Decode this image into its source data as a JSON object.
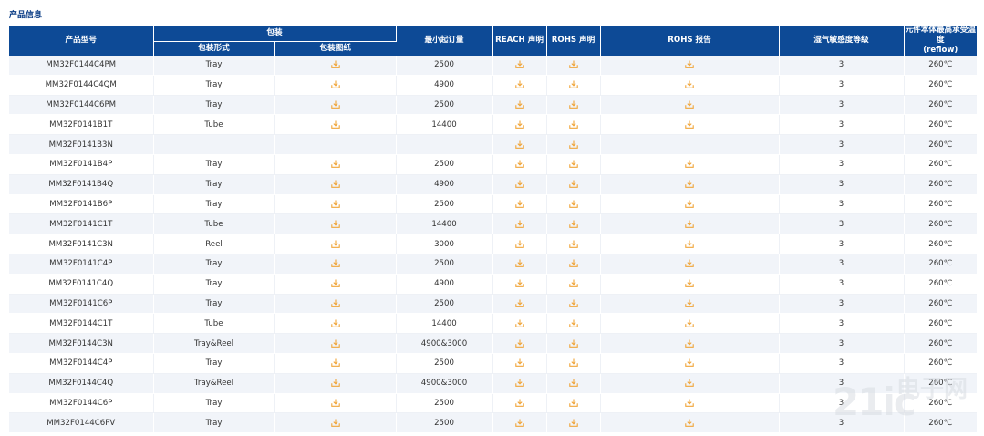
{
  "section_title": "产品信息",
  "header": {
    "model": "产品型号",
    "packaging": "包装",
    "packaging_form": "包装形式",
    "packaging_drawing": "包装图纸",
    "moq": "最小起订量",
    "reach": "REACH 声明",
    "rohs_decl": "ROHS 声明",
    "rohs_report": "ROHS 报告",
    "msl": "湿气敏感度等级",
    "reflow_line1": "元件本体最高承受温度",
    "reflow_line2": "(reflow)"
  },
  "icons": {
    "download": "download-icon",
    "color": "#f0a53a"
  },
  "colors": {
    "header_bg": "#0d4a96",
    "title": "#0d3e86"
  },
  "rows": [
    {
      "model": "MM32F0144C4PM",
      "form": "Tray",
      "drawing": true,
      "moq": "2500",
      "reach": true,
      "rohs": true,
      "report": true,
      "msl": "3",
      "temp": "260℃"
    },
    {
      "model": "MM32F0144C4QM",
      "form": "Tray",
      "drawing": true,
      "moq": "4900",
      "reach": true,
      "rohs": true,
      "report": true,
      "msl": "3",
      "temp": "260℃"
    },
    {
      "model": "MM32F0144C6PM",
      "form": "Tray",
      "drawing": true,
      "moq": "2500",
      "reach": true,
      "rohs": true,
      "report": true,
      "msl": "3",
      "temp": "260℃"
    },
    {
      "model": "MM32F0141B1T",
      "form": "Tube",
      "drawing": true,
      "moq": "14400",
      "reach": true,
      "rohs": true,
      "report": true,
      "msl": "3",
      "temp": "260℃"
    },
    {
      "model": "MM32F0141B3N",
      "form": "",
      "drawing": false,
      "moq": "",
      "reach": true,
      "rohs": true,
      "report": false,
      "msl": "3",
      "temp": "260℃"
    },
    {
      "model": "MM32F0141B4P",
      "form": "Tray",
      "drawing": true,
      "moq": "2500",
      "reach": true,
      "rohs": true,
      "report": true,
      "msl": "3",
      "temp": "260℃"
    },
    {
      "model": "MM32F0141B4Q",
      "form": "Tray",
      "drawing": true,
      "moq": "4900",
      "reach": true,
      "rohs": true,
      "report": true,
      "msl": "3",
      "temp": "260℃"
    },
    {
      "model": "MM32F0141B6P",
      "form": "Tray",
      "drawing": true,
      "moq": "2500",
      "reach": true,
      "rohs": true,
      "report": true,
      "msl": "3",
      "temp": "260℃"
    },
    {
      "model": "MM32F0141C1T",
      "form": "Tube",
      "drawing": true,
      "moq": "14400",
      "reach": true,
      "rohs": true,
      "report": true,
      "msl": "3",
      "temp": "260℃"
    },
    {
      "model": "MM32F0141C3N",
      "form": "Reel",
      "drawing": true,
      "moq": "3000",
      "reach": true,
      "rohs": true,
      "report": true,
      "msl": "3",
      "temp": "260℃"
    },
    {
      "model": "MM32F0141C4P",
      "form": "Tray",
      "drawing": true,
      "moq": "2500",
      "reach": true,
      "rohs": true,
      "report": true,
      "msl": "3",
      "temp": "260℃"
    },
    {
      "model": "MM32F0141C4Q",
      "form": "Tray",
      "drawing": true,
      "moq": "4900",
      "reach": true,
      "rohs": true,
      "report": true,
      "msl": "3",
      "temp": "260℃"
    },
    {
      "model": "MM32F0141C6P",
      "form": "Tray",
      "drawing": true,
      "moq": "2500",
      "reach": true,
      "rohs": true,
      "report": true,
      "msl": "3",
      "temp": "260℃"
    },
    {
      "model": "MM32F0144C1T",
      "form": "Tube",
      "drawing": true,
      "moq": "14400",
      "reach": true,
      "rohs": true,
      "report": true,
      "msl": "3",
      "temp": "260℃"
    },
    {
      "model": "MM32F0144C3N",
      "form": "Tray&Reel",
      "drawing": true,
      "moq": "4900&3000",
      "reach": true,
      "rohs": true,
      "report": true,
      "msl": "3",
      "temp": "260℃"
    },
    {
      "model": "MM32F0144C4P",
      "form": "Tray",
      "drawing": true,
      "moq": "2500",
      "reach": true,
      "rohs": true,
      "report": true,
      "msl": "3",
      "temp": "260℃"
    },
    {
      "model": "MM32F0144C4Q",
      "form": "Tray&Reel",
      "drawing": true,
      "moq": "4900&3000",
      "reach": true,
      "rohs": true,
      "report": true,
      "msl": "3",
      "temp": "260℃"
    },
    {
      "model": "MM32F0144C6P",
      "form": "Tray",
      "drawing": true,
      "moq": "2500",
      "reach": true,
      "rohs": true,
      "report": true,
      "msl": "3",
      "temp": "260℃"
    },
    {
      "model": "MM32F0144C6PV",
      "form": "Tray",
      "drawing": true,
      "moq": "2500",
      "reach": true,
      "rohs": true,
      "report": true,
      "msl": "3",
      "temp": "260℃"
    }
  ],
  "watermark": {
    "number": "21ic",
    "name": "电子网"
  }
}
